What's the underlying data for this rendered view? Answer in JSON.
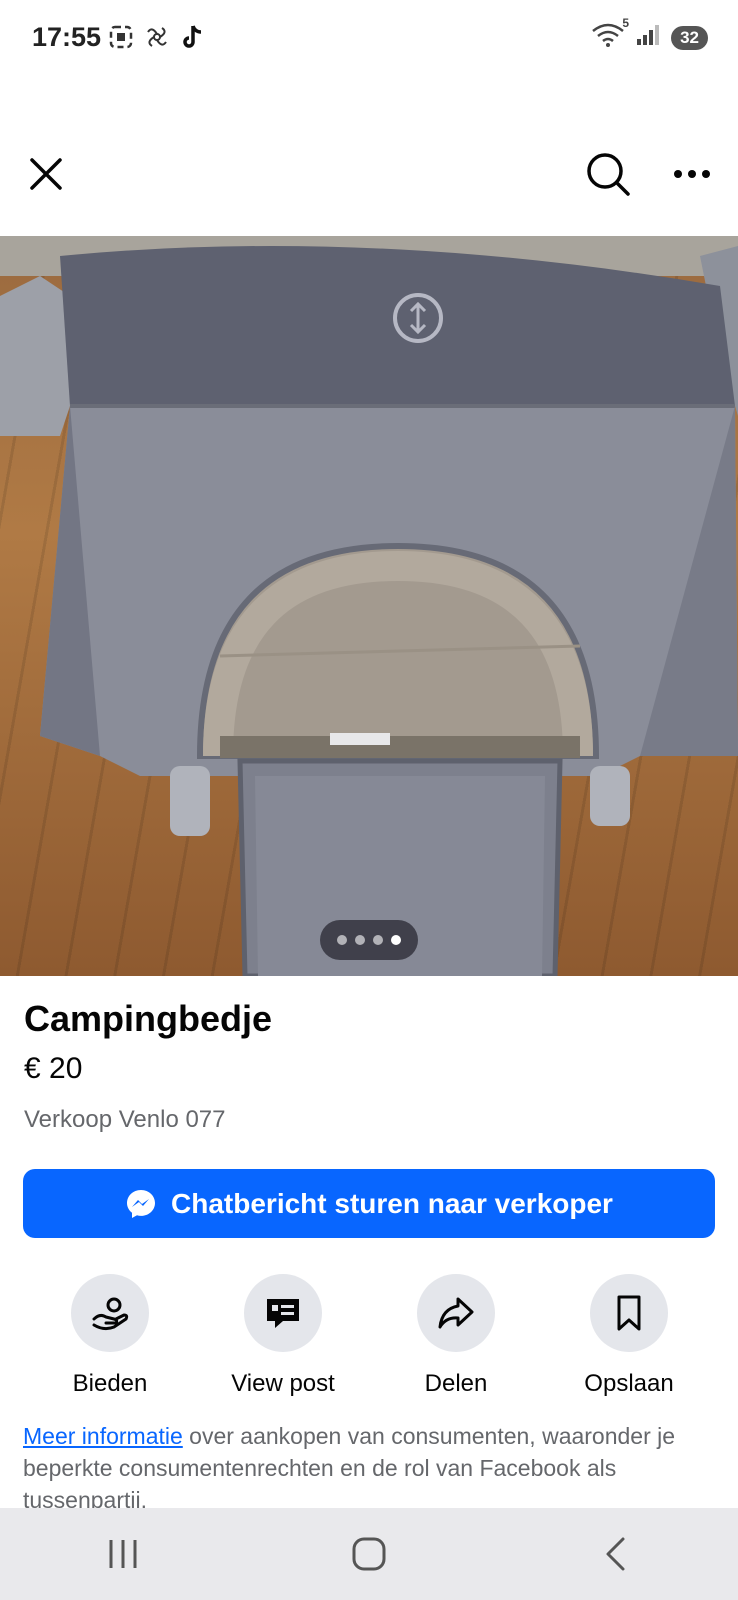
{
  "status": {
    "time": "17:55",
    "battery": "32",
    "network_sup": "5"
  },
  "topbar": {
    "close_icon": "close-icon",
    "search_icon": "search-icon",
    "more_icon": "more-horizontal-icon"
  },
  "photo": {
    "image_count": 4,
    "active_index": 4
  },
  "listing": {
    "title": "Campingbedje",
    "price": "€ 20",
    "location": "Verkoop Venlo 077"
  },
  "chat_button": {
    "label": "Chatbericht sturen naar verkoper",
    "icon": "messenger-icon"
  },
  "actions": [
    {
      "label": "Bieden",
      "icon": "offer-hand-icon"
    },
    {
      "label": "View post",
      "icon": "post-bubble-icon"
    },
    {
      "label": "Delen",
      "icon": "share-arrow-icon"
    },
    {
      "label": "Opslaan",
      "icon": "bookmark-icon"
    }
  ],
  "info": {
    "link_text": "Meer informatie",
    "rest_text": " over aankopen van consumenten, waaronder je beperkte consumentenrechten en de rol van Facebook als tussenpartij."
  },
  "colors": {
    "accent": "#0866ff",
    "button_bg": "#e4e6eb",
    "secondary_text": "#65676b"
  }
}
